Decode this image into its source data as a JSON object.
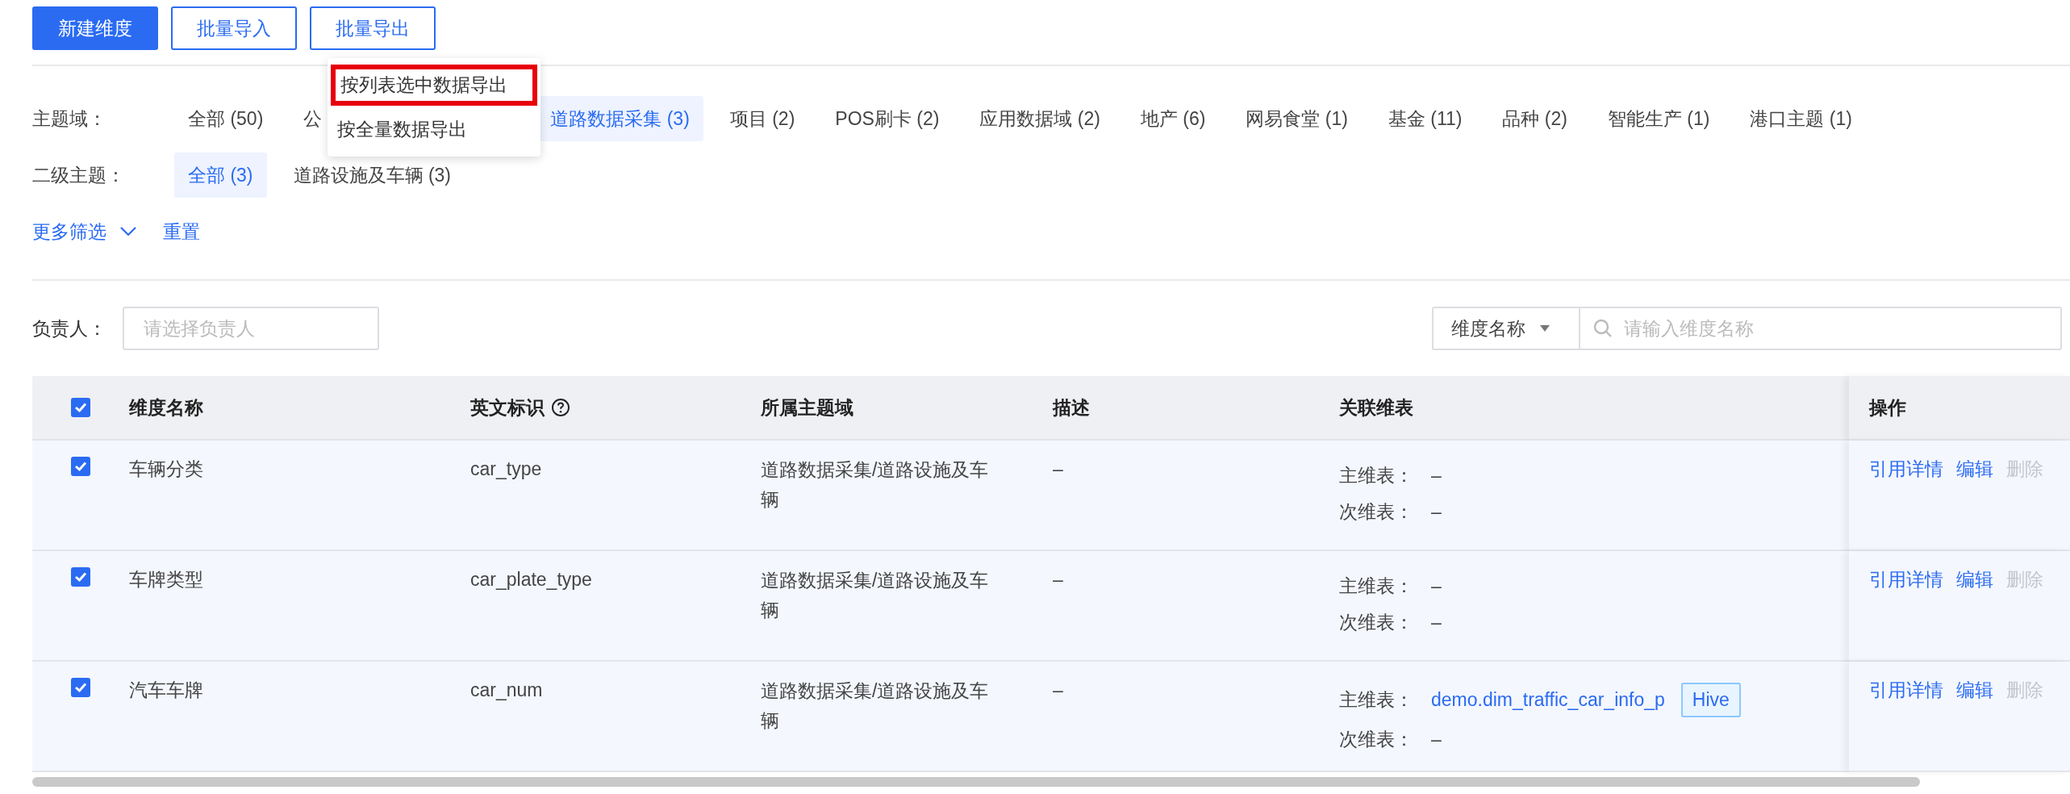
{
  "toolbar": {
    "buttons": [
      {
        "label": "新建维度",
        "kind": "primary"
      },
      {
        "label": "批量导入",
        "kind": "outline"
      },
      {
        "label": "批量导出",
        "kind": "outline"
      }
    ]
  },
  "export_menu": {
    "items": [
      {
        "label": "按列表选中数据导出",
        "highlighted": true
      },
      {
        "label": "按全量数据导出",
        "highlighted": false
      }
    ]
  },
  "filters": [
    {
      "label": "主题域：",
      "options": [
        {
          "label": "全部 (50)",
          "selected": false
        },
        {
          "label": "公",
          "selected": false,
          "kind": "partial"
        },
        {
          "label": "道路数据采集 (3)",
          "selected": true
        },
        {
          "label": "项目 (2)",
          "selected": false
        },
        {
          "label": "POS刷卡 (2)",
          "selected": false
        },
        {
          "label": "应用数据域 (2)",
          "selected": false
        },
        {
          "label": "地产 (6)",
          "selected": false
        },
        {
          "label": "网易食堂 (1)",
          "selected": false
        },
        {
          "label": "基金 (11)",
          "selected": false
        },
        {
          "label": "品种 (2)",
          "selected": false
        },
        {
          "label": "智能生产 (1)",
          "selected": false
        },
        {
          "label": "港口主题 (1)",
          "selected": false
        }
      ]
    },
    {
      "label": "二级主题：",
      "options": [
        {
          "label": "全部 (3)",
          "selected": true
        },
        {
          "label": "道路设施及车辆 (3)",
          "selected": false
        }
      ]
    }
  ],
  "more_filters": "更多筛选",
  "reset": "重置",
  "owner_filter": {
    "label": "负责人：",
    "placeholder": "请选择负责人"
  },
  "search": {
    "field": "维度名称",
    "placeholder": "请输入维度名称"
  },
  "table": {
    "header_checked": true,
    "columns": [
      {
        "label": "维度名称",
        "help": false
      },
      {
        "label": "英文标识",
        "help": true
      },
      {
        "label": "所属主题域",
        "help": false
      },
      {
        "label": "描述",
        "help": false
      },
      {
        "label": "关联维表",
        "help": false
      },
      {
        "label": "操作",
        "help": false
      }
    ],
    "rows": [
      {
        "checked": true,
        "name": "车辆分类",
        "code": "car_type",
        "domain": "道路数据采集/道路设施及车辆",
        "description": "–",
        "primary_label": "主维表：",
        "primary": "–",
        "primary_link": false,
        "secondary_label": "次维表：",
        "secondary": "–",
        "actions": [
          {
            "label": "引用详情",
            "disabled": false
          },
          {
            "label": "编辑",
            "disabled": false
          },
          {
            "label": "删除",
            "disabled": true
          }
        ]
      },
      {
        "checked": true,
        "name": "车牌类型",
        "code": "car_plate_type",
        "domain": "道路数据采集/道路设施及车辆",
        "description": "–",
        "primary_label": "主维表：",
        "primary": "–",
        "primary_link": false,
        "secondary_label": "次维表：",
        "secondary": "–",
        "actions": [
          {
            "label": "引用详情",
            "disabled": false
          },
          {
            "label": "编辑",
            "disabled": false
          },
          {
            "label": "删除",
            "disabled": true
          }
        ]
      },
      {
        "checked": true,
        "name": "汽车车牌",
        "code": "car_num",
        "domain": "道路数据采集/道路设施及车辆",
        "description": "–",
        "primary_label": "主维表：",
        "primary": "demo.dim_traffic_car_info_p",
        "primary_link": true,
        "primary_tag": "Hive",
        "secondary_label": "次维表：",
        "secondary": "–",
        "actions": [
          {
            "label": "引用详情",
            "disabled": false
          },
          {
            "label": "编辑",
            "disabled": false
          },
          {
            "label": "删除",
            "disabled": true
          }
        ]
      }
    ]
  }
}
